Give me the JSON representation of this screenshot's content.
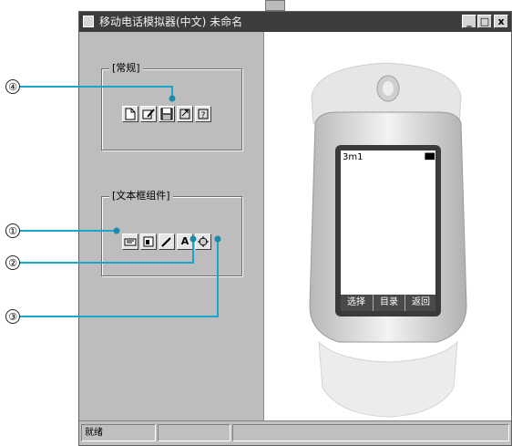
{
  "window": {
    "title": "移动电话模拟器(中文) 未命名",
    "controls": {
      "minimize": "_",
      "maximize": "□",
      "close": "x"
    }
  },
  "groups": [
    {
      "label": "[常规]"
    },
    {
      "label": "[文本框组件]"
    }
  ],
  "general_toolbar": [
    "new-file-icon",
    "edit-icon",
    "save-icon",
    "export-icon",
    "help-icon"
  ],
  "text_toolbar": [
    "phone-text-icon",
    "frame-icon",
    "pencil-icon",
    "letter-a-icon",
    "settings-icon"
  ],
  "text_toolbar_labels": {
    "letter_a": "A"
  },
  "callouts": [
    "④",
    "①",
    "②",
    "③"
  ],
  "phone": {
    "status_left": "3m1",
    "battery": "▮▮▮",
    "softkeys": [
      "选择",
      "目录",
      "返回"
    ]
  },
  "statusbar": {
    "ready": "就绪"
  },
  "colors": {
    "titlebar": "#3c3c3c",
    "panel": "#bdbdbd",
    "callout_line": "#1aa6cc",
    "callout_dot": "#1a8aaa"
  }
}
